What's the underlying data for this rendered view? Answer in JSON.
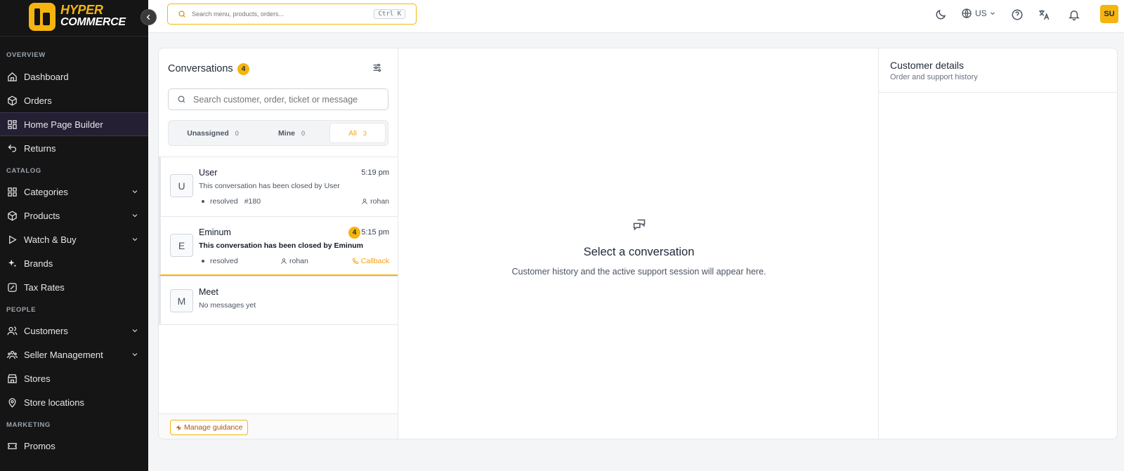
{
  "brand": {
    "line1": "HYPER",
    "line2": "COMMERCE",
    "accent": "#f5b50e"
  },
  "sidebar": {
    "sections": [
      {
        "label": "OVERVIEW",
        "items": [
          {
            "label": "Dashboard",
            "icon": "home-icon"
          },
          {
            "label": "Orders",
            "icon": "box-icon"
          },
          {
            "label": "Home Page Builder",
            "icon": "layout-icon",
            "active": true
          },
          {
            "label": "Returns",
            "icon": "undo-icon"
          }
        ]
      },
      {
        "label": "CATALOG",
        "items": [
          {
            "label": "Categories",
            "icon": "grid-icon",
            "expandable": true
          },
          {
            "label": "Products",
            "icon": "cube-icon",
            "expandable": true
          },
          {
            "label": "Watch & Buy",
            "icon": "play-icon",
            "expandable": true
          },
          {
            "label": "Brands",
            "icon": "sparkle-icon"
          },
          {
            "label": "Tax Rates",
            "icon": "percent-icon"
          }
        ]
      },
      {
        "label": "PEOPLE",
        "items": [
          {
            "label": "Customers",
            "icon": "users-icon",
            "expandable": true
          },
          {
            "label": "Seller Management",
            "icon": "seller-icon",
            "expandable": true
          },
          {
            "label": "Stores",
            "icon": "store-icon"
          },
          {
            "label": "Store locations",
            "icon": "pin-icon"
          }
        ]
      },
      {
        "label": "MARKETING",
        "items": [
          {
            "label": "Promos",
            "icon": "ticket-icon"
          }
        ]
      }
    ]
  },
  "topbar": {
    "search_placeholder": "Search menu, products, orders...",
    "shortcut": "Ctrl K",
    "locale": "US",
    "avatar_initials": "SU"
  },
  "conversations": {
    "title": "Conversations",
    "count": "4",
    "search_placeholder": "Search customer, order, ticket or message",
    "tabs": [
      {
        "label": "Unassigned",
        "count": "0"
      },
      {
        "label": "Mine",
        "count": "0"
      },
      {
        "label": "All",
        "count": "3",
        "active": true
      }
    ],
    "items": [
      {
        "initial": "U",
        "name": "User",
        "time": "5:19 pm",
        "message": "This conversation has been closed by User",
        "status": "resolved",
        "ticket": "#180",
        "assignee": "rohan"
      },
      {
        "initial": "E",
        "name": "Eminum",
        "time": "5:15 pm",
        "unread": "4",
        "message": "This conversation has been closed by Eminum",
        "status": "resolved",
        "assignee": "rohan",
        "callback": "Callback"
      },
      {
        "initial": "M",
        "name": "Meet",
        "message": "No messages yet"
      }
    ],
    "footer_button": "Manage guidance"
  },
  "center": {
    "title": "Select a conversation",
    "subtitle": "Customer history and the active support session will appear here."
  },
  "details": {
    "title": "Customer details",
    "subtitle": "Order and support history"
  }
}
